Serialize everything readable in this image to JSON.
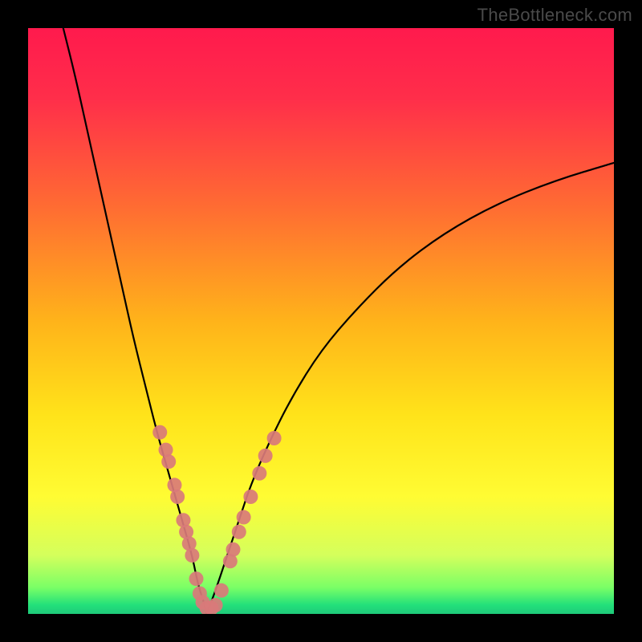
{
  "watermark": "TheBottleneck.com",
  "colors": {
    "frame": "#000000",
    "gradient_stops": [
      {
        "offset": 0.0,
        "color": "#ff1a4d"
      },
      {
        "offset": 0.12,
        "color": "#ff2e4a"
      },
      {
        "offset": 0.3,
        "color": "#ff6a33"
      },
      {
        "offset": 0.5,
        "color": "#ffb31a"
      },
      {
        "offset": 0.66,
        "color": "#ffe31a"
      },
      {
        "offset": 0.8,
        "color": "#fffc33"
      },
      {
        "offset": 0.9,
        "color": "#d4ff5c"
      },
      {
        "offset": 0.955,
        "color": "#7aff66"
      },
      {
        "offset": 0.985,
        "color": "#22e07a"
      },
      {
        "offset": 1.0,
        "color": "#1fc97a"
      }
    ],
    "curve": "#000000",
    "marker_fill": "#d97a7a",
    "marker_stroke": "#c46464"
  },
  "chart_data": {
    "type": "line",
    "title": "",
    "xlabel": "",
    "ylabel": "",
    "xlim": [
      0,
      100
    ],
    "ylim": [
      0,
      100
    ],
    "note": "Axes are unlabeled; values below are estimated normalized coordinates (0–100) read from the plot geometry.",
    "series": [
      {
        "name": "left-branch",
        "x": [
          6,
          8,
          10,
          12,
          14,
          16,
          18,
          20,
          22,
          24,
          26,
          28,
          29,
          30,
          30.5
        ],
        "y": [
          100,
          92,
          83,
          74,
          65,
          56,
          47,
          39,
          31,
          24,
          17,
          10,
          5,
          2,
          0
        ]
      },
      {
        "name": "right-branch",
        "x": [
          30.5,
          32,
          34,
          36,
          38,
          41,
          45,
          50,
          56,
          63,
          71,
          80,
          90,
          100
        ],
        "y": [
          0,
          4,
          10,
          16,
          22,
          29,
          37,
          45,
          52,
          59,
          65,
          70,
          74,
          77
        ]
      }
    ],
    "markers": {
      "name": "highlighted-points",
      "points": [
        {
          "x": 22.5,
          "y": 31
        },
        {
          "x": 23.5,
          "y": 28
        },
        {
          "x": 24.0,
          "y": 26
        },
        {
          "x": 25.0,
          "y": 22
        },
        {
          "x": 25.5,
          "y": 20
        },
        {
          "x": 26.5,
          "y": 16
        },
        {
          "x": 27.0,
          "y": 14
        },
        {
          "x": 27.5,
          "y": 12
        },
        {
          "x": 28.0,
          "y": 10
        },
        {
          "x": 28.7,
          "y": 6
        },
        {
          "x": 29.3,
          "y": 3.5
        },
        {
          "x": 29.8,
          "y": 2
        },
        {
          "x": 30.5,
          "y": 1
        },
        {
          "x": 31.3,
          "y": 1
        },
        {
          "x": 32.0,
          "y": 1.5
        },
        {
          "x": 33.0,
          "y": 4
        },
        {
          "x": 34.5,
          "y": 9
        },
        {
          "x": 35.0,
          "y": 11
        },
        {
          "x": 36.0,
          "y": 14
        },
        {
          "x": 36.8,
          "y": 16.5
        },
        {
          "x": 38.0,
          "y": 20
        },
        {
          "x": 39.5,
          "y": 24
        },
        {
          "x": 40.5,
          "y": 27
        },
        {
          "x": 42.0,
          "y": 30
        }
      ]
    }
  }
}
